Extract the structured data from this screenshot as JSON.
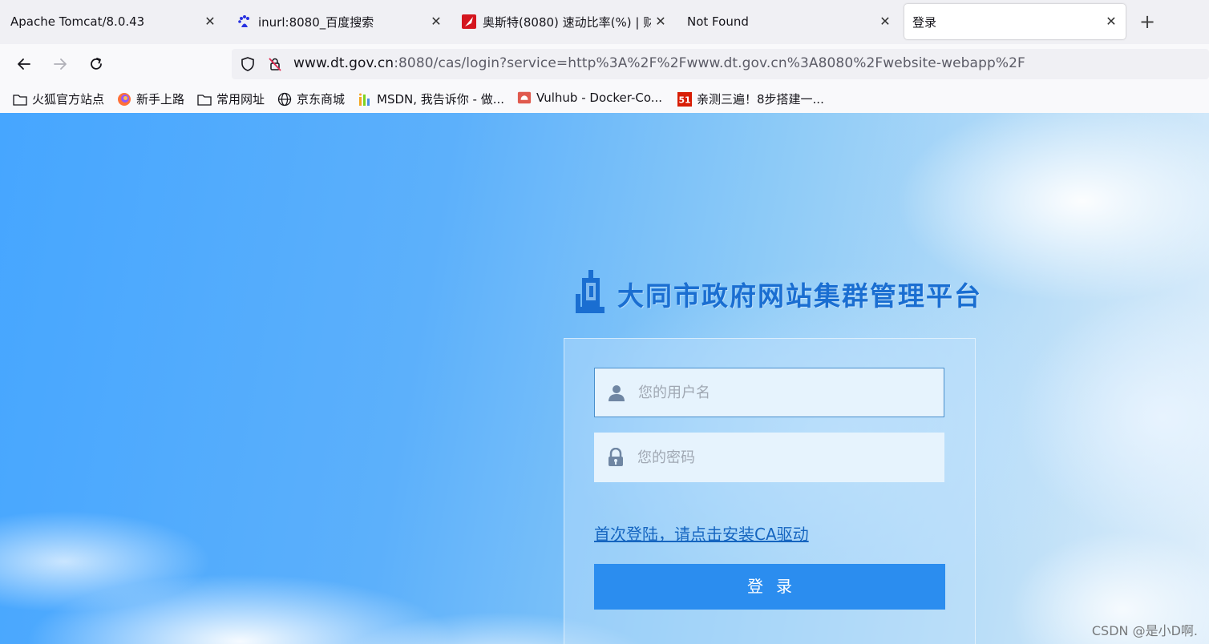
{
  "tabs": [
    {
      "label": "Apache Tomcat/8.0.43",
      "icon": "none",
      "active": false
    },
    {
      "label": "inurl:8080_百度搜索",
      "icon": "baidu-paw-icon",
      "active": false
    },
    {
      "label": "奥斯特(8080) 速动比率(%) | 财",
      "icon": "red-flag-icon",
      "active": false
    },
    {
      "label": "Not Found",
      "icon": "none",
      "active": false
    },
    {
      "label": "登录",
      "icon": "none",
      "active": true
    }
  ],
  "tab_close_glyph": "✕",
  "new_tab_glyph": "+",
  "address": {
    "host": "www.dt.gov.cn",
    "rest": ":8080/cas/login?service=http%3A%2F%2Fwww.dt.gov.cn%3A8080%2Fwebsite-webapp%2F"
  },
  "bookmarks": [
    {
      "label": "火狐官方站点",
      "icon": "folder-icon"
    },
    {
      "label": "新手上路",
      "icon": "firefox-icon"
    },
    {
      "label": "常用网址",
      "icon": "folder-icon"
    },
    {
      "label": "京东商城",
      "icon": "globe-icon"
    },
    {
      "label": "MSDN, 我告诉你 - 做...",
      "icon": "msdn-icon"
    },
    {
      "label": "Vulhub - Docker-Co...",
      "icon": "vulhub-icon"
    },
    {
      "label": "亲测三遍！8步搭建一...",
      "icon": "51cto-icon"
    }
  ],
  "login": {
    "site_title": "大同市政府网站集群管理平台",
    "username_placeholder": "您的用户名",
    "password_placeholder": "您的密码",
    "ca_link": "首次登陆，请点击安装CA驱动",
    "submit_label": "登录"
  },
  "watermark": "CSDN @是小D啊.",
  "colors": {
    "accent_button": "#2b8def",
    "link": "#1565c0",
    "title": "#1a6ed1"
  }
}
